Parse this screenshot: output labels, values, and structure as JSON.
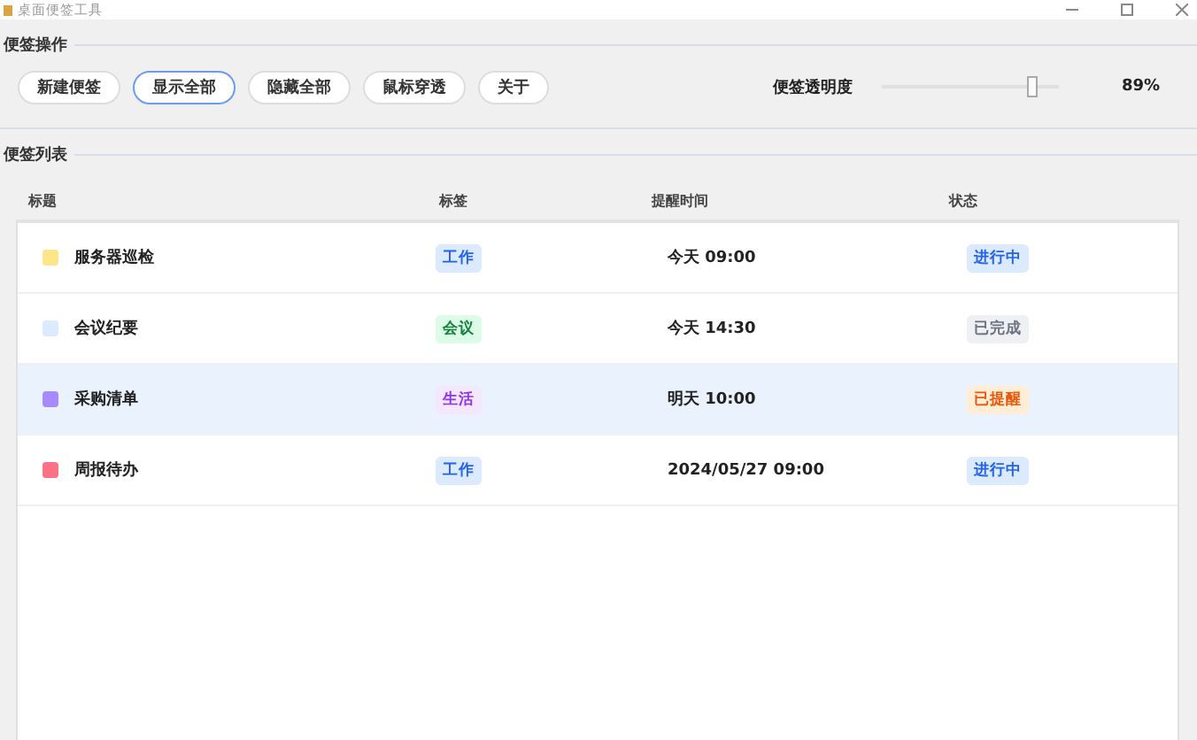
{
  "window": {
    "title": "桌面便签工具"
  },
  "actions": {
    "title": "便签操作",
    "buttons": [
      {
        "label": "新建便签",
        "focused": false
      },
      {
        "label": "显示全部",
        "focused": true
      },
      {
        "label": "隐藏全部",
        "focused": false
      },
      {
        "label": "鼠标穿透",
        "focused": false
      },
      {
        "label": "关于",
        "focused": false
      }
    ],
    "opacity": {
      "label": "便签透明度",
      "level": 0.85,
      "reading": "89%"
    }
  },
  "list": {
    "title": "便签列表",
    "columns": [
      "标题",
      "标签",
      "提醒时间",
      "状态"
    ],
    "rows": [
      {
        "color": "#fde68a",
        "title": "服务器巡检",
        "tag": {
          "label": "工作",
          "kind": "work"
        },
        "time": "今天 09:00",
        "status": {
          "label": "进行中",
          "kind": "active"
        },
        "selected": false
      },
      {
        "color": "#dbeafe",
        "title": "会议纪要",
        "tag": {
          "label": "会议",
          "kind": "meeting"
        },
        "time": "今天 14:30",
        "status": {
          "label": "已完成",
          "kind": "done"
        },
        "selected": false
      },
      {
        "color": "#a78bfa",
        "title": "采购清单",
        "tag": {
          "label": "生活",
          "kind": "life"
        },
        "time": "明天 10:00",
        "status": {
          "label": "已提醒",
          "kind": "reminded"
        },
        "selected": true
      },
      {
        "color": "#fb7185",
        "title": "周报待办",
        "tag": {
          "label": "工作",
          "kind": "work"
        },
        "time": "2024/05/27 09:00",
        "status": {
          "label": "进行中",
          "kind": "active"
        },
        "selected": false
      }
    ]
  }
}
